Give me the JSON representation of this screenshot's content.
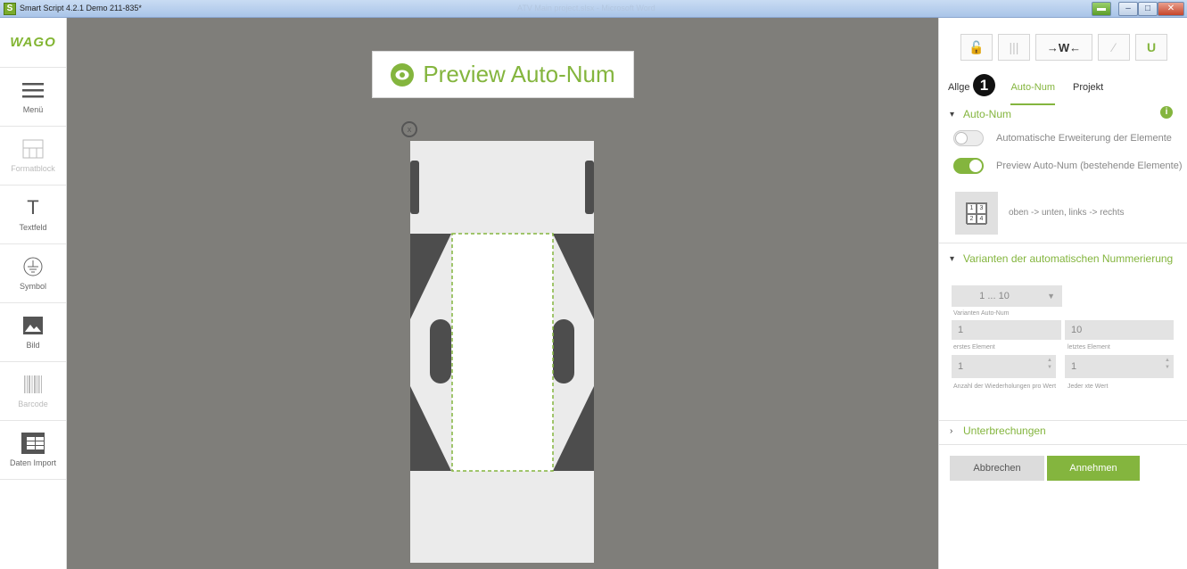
{
  "window": {
    "app_title": "Smart Script 4.2.1  Demo 211-835*",
    "center_title": "ATV Main project.slsx - Microsoft Word",
    "app_icon": "S"
  },
  "sidebar": {
    "logo": "WAGO",
    "items": [
      {
        "label": "Menü",
        "icon": "menu-icon",
        "enabled": true
      },
      {
        "label": "Formatblock",
        "icon": "formatblock-icon",
        "enabled": false
      },
      {
        "label": "Textfeld",
        "icon": "text-icon",
        "enabled": true
      },
      {
        "label": "Symbol",
        "icon": "ground-symbol-icon",
        "enabled": true
      },
      {
        "label": "Bild",
        "icon": "image-icon",
        "enabled": true
      },
      {
        "label": "Barcode",
        "icon": "barcode-icon",
        "enabled": false
      },
      {
        "label": "Daten Import",
        "icon": "table-icon",
        "enabled": true
      }
    ]
  },
  "canvas": {
    "preview_banner": "Preview Auto-Num",
    "close_marker": "x"
  },
  "panel": {
    "toolbar": {
      "lock": "lock-icon",
      "columns": "columns-icon",
      "wago_arrows": "→W←",
      "wand": "magic-wand-icon",
      "magnet": "magnet-icon"
    },
    "tabs": [
      {
        "label": "Allge",
        "active": false
      },
      {
        "label": "Auto-Num",
        "active": true
      },
      {
        "label": "Projekt",
        "active": false
      }
    ],
    "callout": "1",
    "auto_num": {
      "heading": "Auto-Num",
      "toggle1_label": "Automatische Erweiterung der Elemente",
      "toggle1_on": false,
      "toggle2_label": "Preview Auto-Num (bestehende Elemente)",
      "toggle2_on": true,
      "order_grid": [
        "1",
        "3",
        "2",
        "4"
      ],
      "order_text": "oben -> unten, links -> rechts"
    },
    "variants": {
      "heading": "Varianten der automatischen Nummerierung",
      "select_value": "1 ... 10",
      "select_label": "Varianten Auto-Num",
      "first_value": "1",
      "first_label": "erstes Element",
      "last_value": "10",
      "last_label": "letztes Element",
      "repeat_value": "1",
      "repeat_label": "Anzahl der Wiederholungen pro Wert",
      "nth_value": "1",
      "nth_label": "Jeder xte Wert"
    },
    "interruptions": {
      "heading": "Unterbrechungen"
    },
    "buttons": {
      "cancel": "Abbrechen",
      "accept": "Annehmen"
    }
  },
  "colors": {
    "accent_green": "#84b53e",
    "canvas_gray": "#7f7e7a",
    "marker_dark": "#4d4d4d"
  }
}
